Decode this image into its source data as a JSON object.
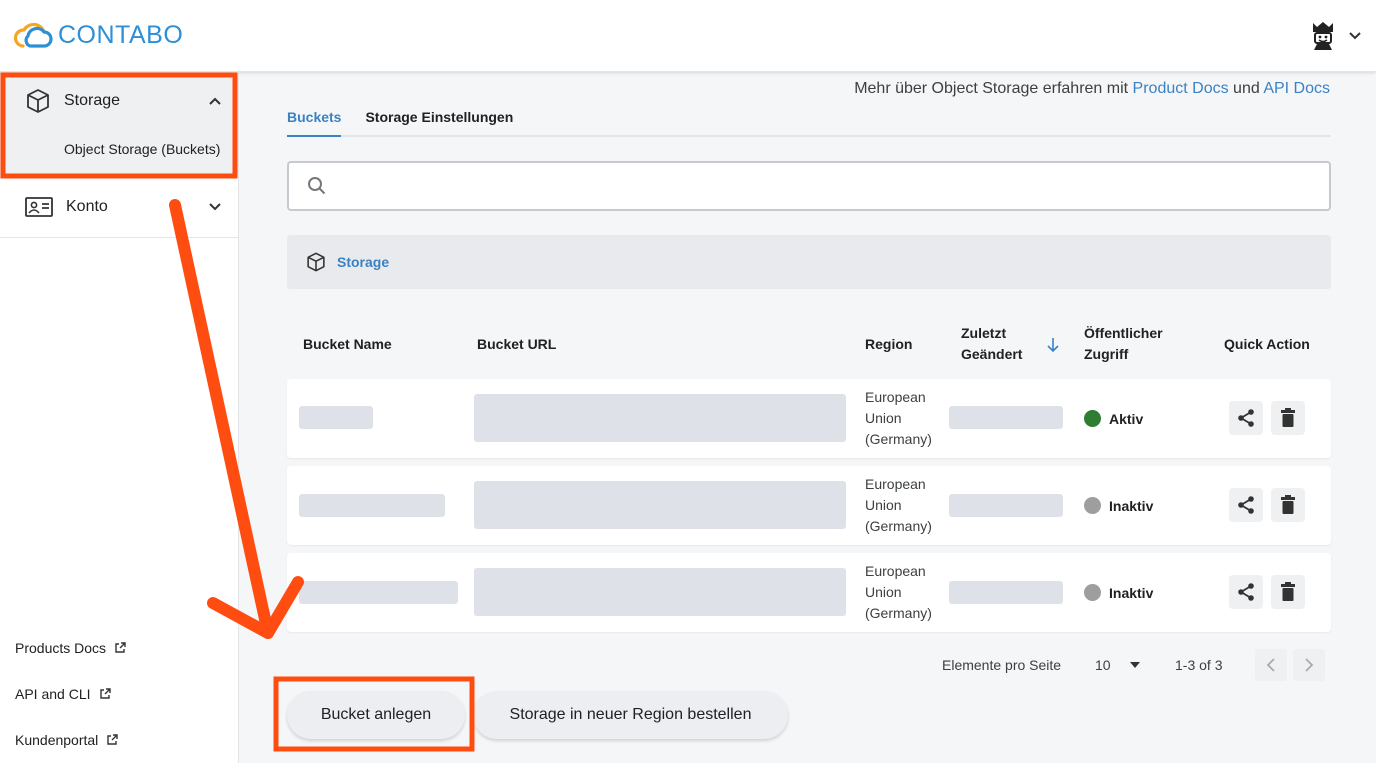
{
  "header": {
    "logo_text": "CONTABO",
    "user_icon": "jester-avatar-icon"
  },
  "sidebar": {
    "storage_label": "Storage",
    "object_storage_label": "Object Storage (Buckets)",
    "konto_label": "Konto",
    "links": [
      {
        "label": "Products Docs"
      },
      {
        "label": "API and CLI"
      },
      {
        "label": "Kundenportal"
      }
    ]
  },
  "main": {
    "docs_prefix": "Mehr über Object Storage erfahren mit",
    "docs_link1": "Product Docs",
    "docs_and": "und",
    "docs_link2": "API Docs",
    "tabs": [
      {
        "label": "Buckets",
        "active": true
      },
      {
        "label": "Storage Einstellungen",
        "active": false
      }
    ],
    "search_placeholder": "",
    "breadcrumb": "Storage",
    "table": {
      "headers": {
        "name": "Bucket Name",
        "url": "Bucket URL",
        "region": "Region",
        "modified_1": "Zuletzt",
        "modified_2": "Geändert",
        "public_1": "Öffentlicher",
        "public_2": "Zugriff",
        "quick_action": "Quick Action"
      },
      "rows": [
        {
          "region_1": "European",
          "region_2": "Union",
          "region_3": "(Germany)",
          "status": "Aktiv",
          "status_color": "#2e7d32"
        },
        {
          "region_1": "European",
          "region_2": "Union",
          "region_3": "(Germany)",
          "status": "Inaktiv",
          "status_color": "#9e9e9e"
        },
        {
          "region_1": "European",
          "region_2": "Union",
          "region_3": "(Germany)",
          "status": "Inaktiv",
          "status_color": "#9e9e9e"
        }
      ]
    },
    "pagination": {
      "per_page_label": "Elemente pro Seite",
      "per_page_value": "10",
      "range": "1-3 of 3"
    },
    "buttons": {
      "create_bucket": "Bucket anlegen",
      "order_storage": "Storage in neuer Region bestellen"
    }
  },
  "colors": {
    "accent": "#3b82c4",
    "annotation": "#ff4d12"
  }
}
